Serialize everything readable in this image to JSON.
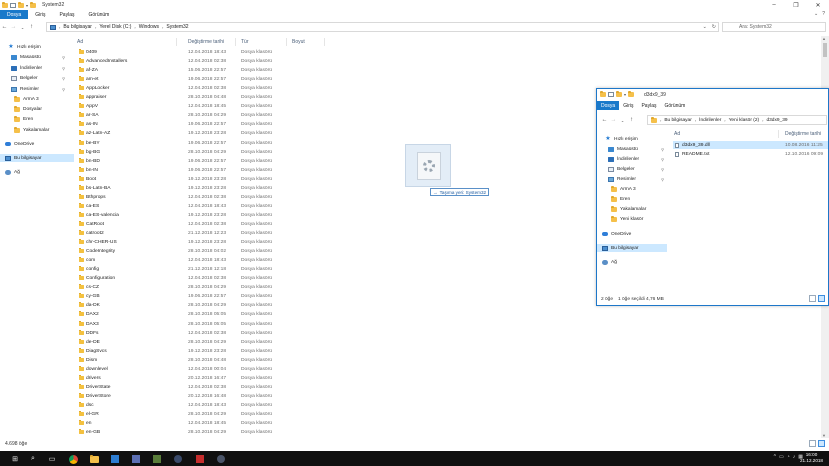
{
  "main": {
    "title": "System32",
    "ribbon_tabs": [
      "Dosya",
      "Giriş",
      "Paylaş",
      "Görünüm"
    ],
    "breadcrumb": [
      "Bu bilgisayar",
      "Yerel Disk (C:)",
      "Windows",
      "System32"
    ],
    "search_placeholder": "Ara: System32",
    "columns": [
      "Ad",
      "Değiştirme tarihi",
      "Tür",
      "Boyut"
    ],
    "sidebar": [
      {
        "label": "Hızlı erişim",
        "icon": "star-icon",
        "pinned": false
      },
      {
        "label": "Masaüstü",
        "icon": "desktop-icon",
        "pinned": true
      },
      {
        "label": "İndirilenler",
        "icon": "downloads-icon",
        "pinned": true
      },
      {
        "label": "Belgeler",
        "icon": "documents-icon",
        "pinned": true
      },
      {
        "label": "Resimler",
        "icon": "pictures-icon",
        "pinned": true
      },
      {
        "label": "ArmA 3",
        "icon": "folder-icon",
        "pinned": false
      },
      {
        "label": "Dosyalar",
        "icon": "folder-icon",
        "pinned": false
      },
      {
        "label": "Eren",
        "icon": "folder-icon",
        "pinned": false
      },
      {
        "label": "Yakalamalar",
        "icon": "folder-icon",
        "pinned": false
      },
      {
        "label": "OneDrive",
        "icon": "onedrive-icon",
        "pinned": false
      },
      {
        "label": "Bu bilgisayar",
        "icon": "this-pc-icon",
        "pinned": false
      },
      {
        "label": "Ağ",
        "icon": "network-icon",
        "pinned": false
      }
    ],
    "files": [
      {
        "name": "0409",
        "date": "12.04.2018 18:43",
        "type": "Dosya klasörü"
      },
      {
        "name": "AdvancedInstallers",
        "date": "12.04.2018 02:38",
        "type": "Dosya klasörü"
      },
      {
        "name": "af-ZA",
        "date": "15.06.2018 22:57",
        "type": "Dosya klasörü"
      },
      {
        "name": "am-et",
        "date": "19.06.2018 22:57",
        "type": "Dosya klasörü"
      },
      {
        "name": "AppLocker",
        "date": "12.04.2018 02:38",
        "type": "Dosya klasörü"
      },
      {
        "name": "appraiser",
        "date": "28.10.2018 04:48",
        "type": "Dosya klasörü"
      },
      {
        "name": "AppV",
        "date": "12.04.2018 18:45",
        "type": "Dosya klasörü"
      },
      {
        "name": "ar-SA",
        "date": "28.10.2018 04:29",
        "type": "Dosya klasörü"
      },
      {
        "name": "as-IN",
        "date": "19.06.2018 22:57",
        "type": "Dosya klasörü"
      },
      {
        "name": "az-Latn-AZ",
        "date": "19.12.2018 23:28",
        "type": "Dosya klasörü"
      },
      {
        "name": "be-BY",
        "date": "19.06.2018 22:57",
        "type": "Dosya klasörü"
      },
      {
        "name": "bg-BG",
        "date": "28.10.2018 04:29",
        "type": "Dosya klasörü"
      },
      {
        "name": "bn-BD",
        "date": "19.06.2018 22:57",
        "type": "Dosya klasörü"
      },
      {
        "name": "bn-IN",
        "date": "19.06.2018 22:57",
        "type": "Dosya klasörü"
      },
      {
        "name": "Boot",
        "date": "19.12.2018 23:28",
        "type": "Dosya klasörü"
      },
      {
        "name": "bs-Latn-BA",
        "date": "19.12.2018 23:28",
        "type": "Dosya klasörü"
      },
      {
        "name": "Bthprops",
        "date": "12.04.2018 02:38",
        "type": "Dosya klasörü"
      },
      {
        "name": "ca-ES",
        "date": "12.04.2018 18:43",
        "type": "Dosya klasörü"
      },
      {
        "name": "ca-ES-valencia",
        "date": "19.12.2018 23:28",
        "type": "Dosya klasörü"
      },
      {
        "name": "CatRoot",
        "date": "12.04.2018 02:38",
        "type": "Dosya klasörü"
      },
      {
        "name": "catroot2",
        "date": "21.12.2018 12:23",
        "type": "Dosya klasörü"
      },
      {
        "name": "chr-CHER-US",
        "date": "19.12.2018 23:28",
        "type": "Dosya klasörü"
      },
      {
        "name": "CodeIntegrity",
        "date": "28.10.2018 04:02",
        "type": "Dosya klasörü"
      },
      {
        "name": "com",
        "date": "12.04.2018 18:43",
        "type": "Dosya klasörü"
      },
      {
        "name": "config",
        "date": "21.12.2018 12:18",
        "type": "Dosya klasörü"
      },
      {
        "name": "Configuration",
        "date": "12.04.2018 02:38",
        "type": "Dosya klasörü"
      },
      {
        "name": "cs-CZ",
        "date": "28.10.2018 04:29",
        "type": "Dosya klasörü"
      },
      {
        "name": "cy-GB",
        "date": "19.06.2018 22:57",
        "type": "Dosya klasörü"
      },
      {
        "name": "da-DK",
        "date": "28.10.2018 04:29",
        "type": "Dosya klasörü"
      },
      {
        "name": "DAX2",
        "date": "28.10.2018 05:05",
        "type": "Dosya klasörü"
      },
      {
        "name": "DAX3",
        "date": "28.10.2018 05:05",
        "type": "Dosya klasörü"
      },
      {
        "name": "DDFs",
        "date": "12.04.2018 02:38",
        "type": "Dosya klasörü"
      },
      {
        "name": "de-DE",
        "date": "28.10.2018 04:29",
        "type": "Dosya klasörü"
      },
      {
        "name": "DiagSvcs",
        "date": "19.12.2018 23:28",
        "type": "Dosya klasörü"
      },
      {
        "name": "Dism",
        "date": "28.10.2018 04:48",
        "type": "Dosya klasörü"
      },
      {
        "name": "downlevel",
        "date": "12.04.2018 00:04",
        "type": "Dosya klasörü"
      },
      {
        "name": "drivers",
        "date": "20.12.2018 16:47",
        "type": "Dosya klasörü"
      },
      {
        "name": "DriverState",
        "date": "12.04.2018 02:38",
        "type": "Dosya klasörü"
      },
      {
        "name": "DriverStore",
        "date": "20.12.2018 16:48",
        "type": "Dosya klasörü"
      },
      {
        "name": "dsc",
        "date": "12.04.2018 18:43",
        "type": "Dosya klasörü"
      },
      {
        "name": "el-GR",
        "date": "28.10.2018 04:29",
        "type": "Dosya klasörü"
      },
      {
        "name": "en",
        "date": "12.04.2018 18:45",
        "type": "Dosya klasörü"
      },
      {
        "name": "en-GB",
        "date": "28.10.2018 04:29",
        "type": "Dosya klasörü"
      }
    ],
    "status": "4.698 öğe"
  },
  "drag": {
    "tooltip": "Taşıma yeri: System32"
  },
  "second": {
    "title": "d3dx9_39",
    "ribbon_tabs": [
      "Dosya",
      "Giriş",
      "Paylaş",
      "Görünüm"
    ],
    "breadcrumb": [
      "Bu bilgisayar",
      "İndirilenler",
      "Yeni klasör (2)",
      "d3dx9_39"
    ],
    "columns": [
      "Ad",
      "Değiştirme tarihi"
    ],
    "sidebar": [
      {
        "label": "Hızlı erişim",
        "icon": "star-icon",
        "pinned": false
      },
      {
        "label": "Masaüstü",
        "icon": "desktop-icon",
        "pinned": true
      },
      {
        "label": "İndirilenler",
        "icon": "downloads-icon",
        "pinned": true
      },
      {
        "label": "Belgeler",
        "icon": "documents-icon",
        "pinned": true
      },
      {
        "label": "Resimler",
        "icon": "pictures-icon",
        "pinned": true
      },
      {
        "label": "ArmA 3",
        "icon": "folder-icon",
        "pinned": false
      },
      {
        "label": "Eren",
        "icon": "folder-icon",
        "pinned": false
      },
      {
        "label": "Yakalamalar",
        "icon": "folder-icon",
        "pinned": false
      },
      {
        "label": "Yeni klasör",
        "icon": "folder-icon",
        "pinned": false
      },
      {
        "label": "OneDrive",
        "icon": "onedrive-icon",
        "pinned": false
      },
      {
        "label": "Bu bilgisayar",
        "icon": "this-pc-icon",
        "pinned": false
      },
      {
        "label": "Ağ",
        "icon": "network-icon",
        "pinned": false
      }
    ],
    "files": [
      {
        "name": "d3dx9_39.dll",
        "date": "10.08.2016 11:25",
        "selected": true
      },
      {
        "name": "README.txt",
        "date": "12.10.2016 09:09",
        "selected": false
      }
    ],
    "status_count": "2 öğe",
    "status_selected": "1 öğe seçildi  4,76 MB"
  },
  "taskbar": {
    "time": "16:00",
    "date": "21.12.2018"
  }
}
